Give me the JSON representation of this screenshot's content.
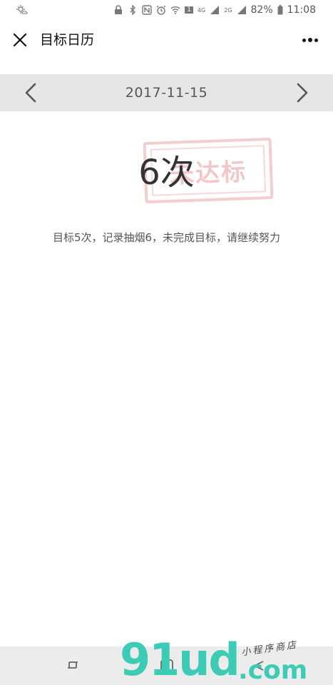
{
  "status_bar": {
    "battery": "82%",
    "time": "11:08",
    "net_4g": "4G",
    "net_2g": "2G",
    "sim": "1"
  },
  "header": {
    "title": "目标日历"
  },
  "date_nav": {
    "date": "2017-11-15"
  },
  "result": {
    "count_label": "6次",
    "stamp_text": "未达标",
    "message": "目标5次，记录抽烟6，未完成目标，请继续努力"
  },
  "colors": {
    "date_bar_bg": "#e6e6e6",
    "stamp": "#d65050",
    "watermark": "#3ccbb4"
  },
  "watermark": {
    "logo": "91ud",
    "suffix": ".com",
    "tag": "小程序商店"
  }
}
